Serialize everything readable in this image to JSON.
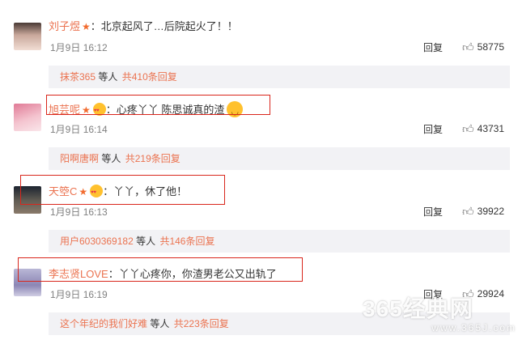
{
  "comments": [
    {
      "username": "刘子煜",
      "text": "：北京起风了…后院起火了！！",
      "date": "1月9日",
      "time": "16:12",
      "reply_label": "回复",
      "likes": "58775",
      "sub": {
        "user": "抹茶365",
        "mid": "等人",
        "count": "共410条回复"
      }
    },
    {
      "username": "旭芸呢",
      "text": "：心疼丫丫 陈思诚真的渣",
      "date": "1月9日",
      "time": "16:14",
      "reply_label": "回复",
      "likes": "43731",
      "sub": {
        "user": "阳啊唐啊",
        "mid": "等人",
        "count": "共219条回复"
      }
    },
    {
      "username": "天箜C",
      "text": "：丫丫，休了他！",
      "date": "1月9日",
      "time": "16:13",
      "reply_label": "回复",
      "likes": "39922",
      "sub": {
        "user": "用户6030369182",
        "mid": "等人",
        "count": "共146条回复"
      }
    },
    {
      "username": "李志贤LOVE",
      "text": "：丫丫心疼你，你渣男老公又出轨了",
      "date": "1月9日",
      "time": "16:19",
      "reply_label": "回复",
      "likes": "29924",
      "sub": {
        "user": "这个年纪的我们好难",
        "mid": "等人",
        "count": "共223条回复"
      }
    }
  ],
  "watermark": {
    "main": "365经典网",
    "sub": "www.365J.com"
  },
  "colors": {
    "username": "#eb7350",
    "highlight_box": "#d9261c",
    "sub_bar": "#f2f2f5"
  },
  "icons": {
    "verified": "star-badge-icon",
    "like": "thumbs-up-icon",
    "emoji": "emoji-icon"
  }
}
